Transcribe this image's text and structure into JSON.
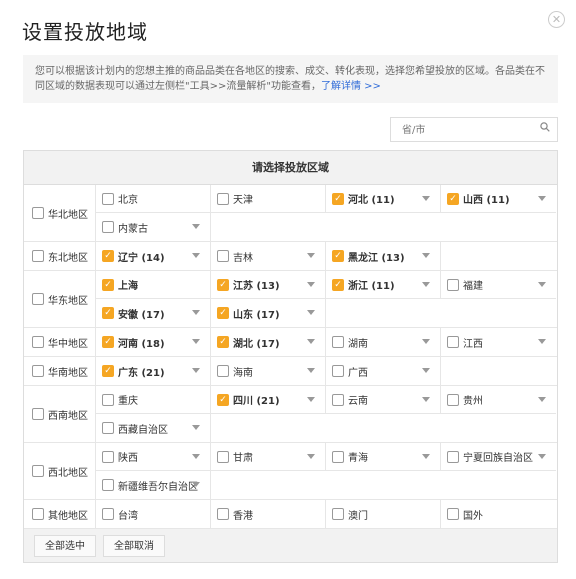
{
  "dialog": {
    "title": "设置投放地域",
    "notice_text": "您可以根据该计划内的您想主推的商品品类在各地区的搜索、成交、转化表现，选择您希望投放的区域。各品类在不同区域的数据表现可以通过左侧栏\"工具>>流量解析\"功能查看，",
    "notice_link": "了解详情 >>"
  },
  "search": {
    "placeholder": "省/市"
  },
  "table": {
    "header": "请选择投放区域",
    "regions": [
      {
        "name": "华北地区",
        "lines": [
          [
            {
              "label": "北京",
              "checked": false,
              "caret": false
            },
            {
              "label": "天津",
              "checked": false,
              "caret": false
            },
            {
              "label": "河北 (11)",
              "checked": true,
              "caret": true
            },
            {
              "label": "山西 (11)",
              "checked": true,
              "caret": true
            }
          ],
          [
            {
              "label": "内蒙古",
              "checked": false,
              "caret": true
            }
          ]
        ]
      },
      {
        "name": "东北地区",
        "lines": [
          [
            {
              "label": "辽宁 (14)",
              "checked": true,
              "caret": true
            },
            {
              "label": "吉林",
              "checked": false,
              "caret": true
            },
            {
              "label": "黑龙江 (13)",
              "checked": true,
              "caret": true
            }
          ]
        ]
      },
      {
        "name": "华东地区",
        "lines": [
          [
            {
              "label": "上海",
              "checked": true,
              "caret": false
            },
            {
              "label": "江苏 (13)",
              "checked": true,
              "caret": true
            },
            {
              "label": "浙江 (11)",
              "checked": true,
              "caret": true
            },
            {
              "label": "福建",
              "checked": false,
              "caret": true
            }
          ],
          [
            {
              "label": "安徽 (17)",
              "checked": true,
              "caret": true
            },
            {
              "label": "山东 (17)",
              "checked": true,
              "caret": true
            }
          ]
        ]
      },
      {
        "name": "华中地区",
        "lines": [
          [
            {
              "label": "河南 (18)",
              "checked": true,
              "caret": true
            },
            {
              "label": "湖北 (17)",
              "checked": true,
              "caret": true
            },
            {
              "label": "湖南",
              "checked": false,
              "caret": true
            },
            {
              "label": "江西",
              "checked": false,
              "caret": true
            }
          ]
        ]
      },
      {
        "name": "华南地区",
        "lines": [
          [
            {
              "label": "广东 (21)",
              "checked": true,
              "caret": true
            },
            {
              "label": "海南",
              "checked": false,
              "caret": true
            },
            {
              "label": "广西",
              "checked": false,
              "caret": true
            }
          ]
        ]
      },
      {
        "name": "西南地区",
        "lines": [
          [
            {
              "label": "重庆",
              "checked": false,
              "caret": false
            },
            {
              "label": "四川 (21)",
              "checked": true,
              "caret": true
            },
            {
              "label": "云南",
              "checked": false,
              "caret": true
            },
            {
              "label": "贵州",
              "checked": false,
              "caret": true
            }
          ],
          [
            {
              "label": "西藏自治区",
              "checked": false,
              "caret": true
            }
          ]
        ]
      },
      {
        "name": "西北地区",
        "lines": [
          [
            {
              "label": "陕西",
              "checked": false,
              "caret": true
            },
            {
              "label": "甘肃",
              "checked": false,
              "caret": true
            },
            {
              "label": "青海",
              "checked": false,
              "caret": true
            },
            {
              "label": "宁夏回族自治区",
              "checked": false,
              "caret": true
            }
          ],
          [
            {
              "label": "新疆维吾尔自治区",
              "checked": false,
              "caret": true
            }
          ]
        ]
      },
      {
        "name": "其他地区",
        "lines": [
          [
            {
              "label": "台湾",
              "checked": false,
              "caret": false
            },
            {
              "label": "香港",
              "checked": false,
              "caret": false
            },
            {
              "label": "澳门",
              "checked": false,
              "caret": false
            },
            {
              "label": "国外",
              "checked": false,
              "caret": false
            }
          ]
        ]
      }
    ]
  },
  "footer": {
    "select_all": "全部选中",
    "deselect_all": "全部取消"
  },
  "colors": {
    "accent": "#f5a623",
    "link": "#2f6bd8"
  },
  "icons": {
    "close": "close-icon",
    "search": "search-icon",
    "checkbox_checked": "checkmark-icon",
    "dropdown": "caret-down-icon"
  }
}
